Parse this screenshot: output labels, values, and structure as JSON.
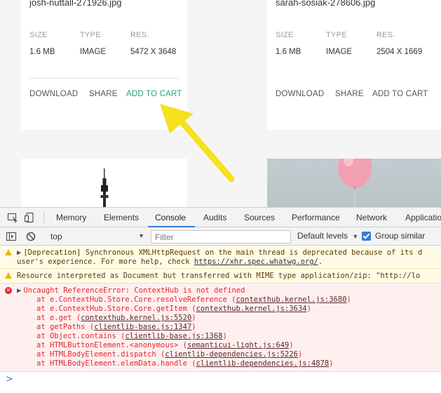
{
  "cards": [
    {
      "filename": "josh-nuttall-271926.jpg",
      "labels": [
        "SIZE",
        "TYPE",
        "RES."
      ],
      "values": [
        "1.6 MB",
        "IMAGE",
        "5472 X 3648"
      ],
      "actions": [
        "DOWNLOAD",
        "SHARE",
        "ADD TO CART"
      ]
    },
    {
      "filename": "sarah-sosiak-278606.jpg",
      "labels": [
        "SIZE",
        "TYPE",
        "RES."
      ],
      "values": [
        "1.6 MB",
        "IMAGE",
        "2504 X 1669"
      ],
      "actions": [
        "DOWNLOAD",
        "SHARE",
        "ADD TO CART"
      ]
    }
  ],
  "colors": {
    "accent_green": "#2aa27a",
    "arrow_yellow": "#f5e11d",
    "devtools_blue": "#3879d9",
    "error_red": "#e0272c",
    "warn_yellow": "#f4b400"
  },
  "devtools": {
    "icons": [
      "inspect-icon",
      "device-toolbar-icon"
    ],
    "tabs": [
      "Memory",
      "Elements",
      "Console",
      "Audits",
      "Sources",
      "Performance",
      "Network",
      "Applicatio"
    ],
    "active_tab": "Console",
    "toolbar": {
      "context": "top",
      "filter_placeholder": "Filter",
      "levels": "Default levels",
      "group_similar": "Group similar",
      "group_similar_checked": true
    }
  },
  "console": {
    "warning1": {
      "line1": "[Deprecation] Synchronous XMLHttpRequest on the main thread is deprecated because of its d",
      "line2_prefix": "user's experience. For more help, check ",
      "line2_link": "https://xhr.spec.whatwg.org/",
      "line2_suffix": "."
    },
    "warning2": {
      "text": "Resource interpreted as Document but transferred with MIME type application/zip: \"http://lo"
    },
    "error": {
      "message": "Uncaught ReferenceError: ContextHub is not defined",
      "stack": [
        {
          "fn": "at e.ContextHub.Store.Core.resolveReference",
          "src": "contexthub.kernel.js:3680"
        },
        {
          "fn": "at e.ContextHub.Store.Core.getItem",
          "src": "contexthub.kernel.js:3634"
        },
        {
          "fn": "at e.get",
          "src": "contexthub.kernel.js:5520"
        },
        {
          "fn": "at getPaths",
          "src": "clientlib-base.js:1347"
        },
        {
          "fn": "at Object.contains",
          "src": "clientlib-base.js:1368"
        },
        {
          "fn": "at HTMLButtonElement.<anonymous>",
          "src": "semanticui-light.js:649"
        },
        {
          "fn": "at HTMLBodyElement.dispatch",
          "src": "clientlib-dependencies.js:5226"
        },
        {
          "fn": "at HTMLBodyElement.elemData.handle",
          "src": "clientlib-dependencies.js:4878"
        }
      ]
    },
    "prompt": ">"
  }
}
